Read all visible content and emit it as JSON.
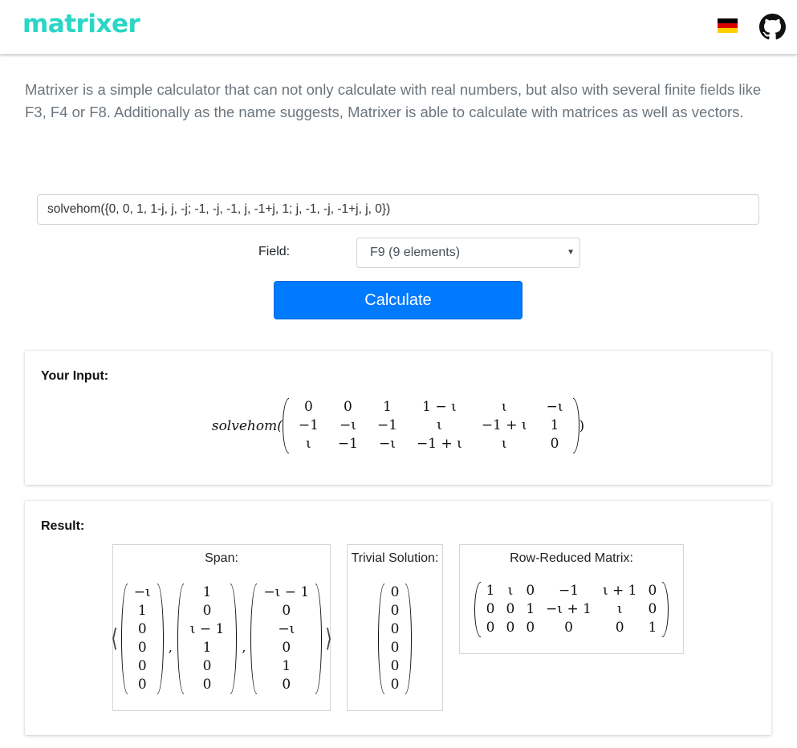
{
  "header": {
    "logo": "matrixer",
    "flag_colors": [
      "#000000",
      "#dd0000",
      "#ffce00"
    ]
  },
  "intro": {
    "text": "Matrixer is a simple calculator that can not only calculate with real numbers, but also with several finite fields like F3, F4 or F8. Additionally as the name suggests, Matrixer is able to calculate with matrices as well as vectors."
  },
  "form": {
    "command": "solvehom({0, 0, 1, 1-j, j, -j; -1, -j, -1, j, -1+j, 1; j, -1, -j, -1+j, j, 0})",
    "field_label": "Field:",
    "field_value": "F9 (9 elements)",
    "calculate_label": "Calculate",
    "accent": "#007bff"
  },
  "input_card": {
    "title": "Your Input:",
    "func": "solvehom(",
    "close": ")",
    "matrix": [
      [
        "0",
        "0",
        "1",
        "1 − ι",
        "ι",
        "−ι"
      ],
      [
        "−1",
        "−ι",
        "−1",
        "ι",
        "−1 + ι",
        "1"
      ],
      [
        "ι",
        "−1",
        "−ι",
        "−1 + ι",
        "ι",
        "0"
      ]
    ]
  },
  "result_card": {
    "title": "Result:",
    "span": {
      "heading": "Span:",
      "open": "⟨",
      "close": "⟩",
      "sep": ",",
      "vectors": [
        [
          "−ι",
          "1",
          "0",
          "0",
          "0",
          "0"
        ],
        [
          "1",
          "0",
          "ι − 1",
          "1",
          "0",
          "0"
        ],
        [
          "−ι − 1",
          "0",
          "−ι",
          "0",
          "1",
          "0"
        ]
      ]
    },
    "trivial": {
      "heading": "Trivial Solution:",
      "vector": [
        "0",
        "0",
        "0",
        "0",
        "0",
        "0"
      ]
    },
    "reduced": {
      "heading": "Row-Reduced Matrix:",
      "matrix": [
        [
          "1",
          "ι",
          "0",
          "−1",
          "ι + 1",
          "0"
        ],
        [
          "0",
          "0",
          "1",
          "−ι + 1",
          "ι",
          "0"
        ],
        [
          "0",
          "0",
          "0",
          "0",
          "0",
          "1"
        ]
      ]
    }
  }
}
